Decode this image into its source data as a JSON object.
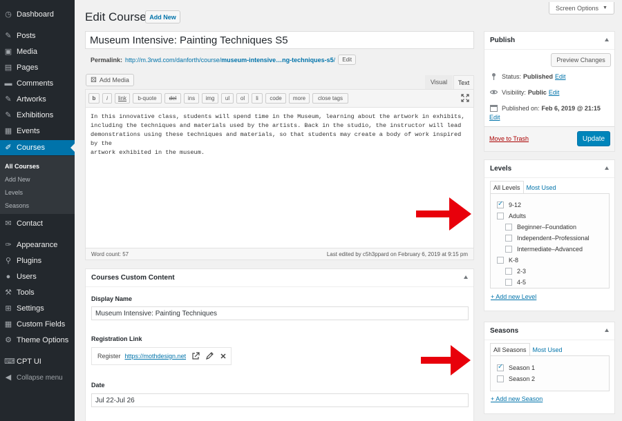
{
  "sidebar": {
    "items": [
      {
        "label": "Dashboard",
        "icon": "dashboard-icon"
      },
      {
        "label": "Posts",
        "icon": "pin-icon"
      },
      {
        "label": "Media",
        "icon": "media-icon"
      },
      {
        "label": "Pages",
        "icon": "pages-icon"
      },
      {
        "label": "Comments",
        "icon": "comments-icon"
      },
      {
        "label": "Artworks",
        "icon": "pin-icon"
      },
      {
        "label": "Exhibitions",
        "icon": "pin-icon"
      },
      {
        "label": "Events",
        "icon": "calendar-icon"
      },
      {
        "label": "Courses",
        "icon": "brush-icon"
      },
      {
        "label": "Contact",
        "icon": "mail-icon"
      },
      {
        "label": "Appearance",
        "icon": "appearance-icon"
      },
      {
        "label": "Plugins",
        "icon": "plugins-icon"
      },
      {
        "label": "Users",
        "icon": "users-icon"
      },
      {
        "label": "Tools",
        "icon": "tools-icon"
      },
      {
        "label": "Settings",
        "icon": "settings-icon"
      },
      {
        "label": "Custom Fields",
        "icon": "grid-icon"
      },
      {
        "label": "Theme Options",
        "icon": "gear-icon"
      },
      {
        "label": "CPT UI",
        "icon": "cpt-icon"
      },
      {
        "label": "Collapse menu",
        "icon": "collapse-icon"
      }
    ],
    "submenu": [
      "All Courses",
      "Add New",
      "Levels",
      "Seasons"
    ]
  },
  "header": {
    "title": "Edit Course",
    "add_new": "Add New",
    "screen_options": "Screen Options"
  },
  "post": {
    "title": "Museum Intensive: Painting Techniques S5",
    "permalink_label": "Permalink:",
    "permalink_base": "http://m.3rwd.com/danforth/course/",
    "permalink_slug": "museum-intensive…ng-techniques-s5",
    "permalink_tail": "/",
    "permalink_edit": "Edit"
  },
  "editor": {
    "add_media": "Add Media",
    "tab_visual": "Visual",
    "tab_text": "Text",
    "quicktags": [
      "b",
      "i",
      "link",
      "b-quote",
      "del",
      "ins",
      "img",
      "ul",
      "ol",
      "li",
      "code",
      "more",
      "close tags"
    ],
    "content_lines": [
      "In this innovative class, students will spend time in the Museum, learning about the artwork in exhibits,",
      "including the techniques and materials used by the artists. Back in the studio, the instructor will lead",
      "demonstrations using these techniques and materials, so that students may create a body of work inspired by the",
      "artwork exhibited in the museum."
    ],
    "word_count": "Word count: 57",
    "last_edited": "Last edited by c5h3ppard on February 6, 2019 at 9:15 pm"
  },
  "custom_content": {
    "title": "Courses Custom Content",
    "display_name_label": "Display Name",
    "display_name_value": "Museum Intensive: Painting Techniques",
    "registration_label": "Registration Link",
    "registration_text": "Register",
    "registration_url": "https://mothdesign.net",
    "date_label": "Date",
    "date_value": "Jul 22-Jul 26"
  },
  "publish": {
    "title": "Publish",
    "preview": "Preview Changes",
    "status_label": "Status:",
    "status_value": "Published",
    "visibility_label": "Visibility:",
    "visibility_value": "Public",
    "published_label": "Published on:",
    "published_value": "Feb 6, 2019 @ 21:15",
    "edit": "Edit",
    "trash": "Move to Trash",
    "update": "Update"
  },
  "levels": {
    "title": "Levels",
    "tab_all": "All Levels",
    "tab_used": "Most Used",
    "items": [
      {
        "label": "9-12",
        "checked": true,
        "depth": 0
      },
      {
        "label": "Adults",
        "checked": false,
        "depth": 0
      },
      {
        "label": "Beginner–Foundation",
        "checked": false,
        "depth": 1
      },
      {
        "label": "Independent–Professional",
        "checked": false,
        "depth": 1
      },
      {
        "label": "Intermediate–Advanced",
        "checked": false,
        "depth": 1
      },
      {
        "label": "K-8",
        "checked": false,
        "depth": 0
      },
      {
        "label": "2-3",
        "checked": false,
        "depth": 1
      },
      {
        "label": "4-5",
        "checked": false,
        "depth": 1
      }
    ],
    "add_new": "+ Add new Level"
  },
  "seasons": {
    "title": "Seasons",
    "tab_all": "All Seasons",
    "tab_used": "Most Used",
    "items": [
      {
        "label": "Season 1",
        "checked": true
      },
      {
        "label": "Season 2",
        "checked": false
      }
    ],
    "add_new": "+ Add new Season"
  },
  "colors": {
    "sidebar_bg": "#23282d",
    "accent": "#0073aa",
    "arrow": "#e8000b"
  }
}
